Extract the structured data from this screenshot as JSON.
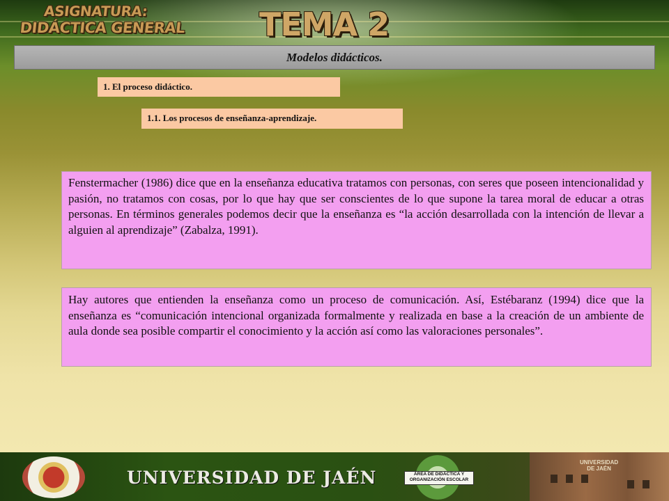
{
  "header": {
    "subject_line1": "ASIGNATURA:",
    "subject_line2": "DIDÁCTICA GENERAL",
    "topic": "TEMA 2"
  },
  "subject_bar": {
    "title": "Modelos didácticos."
  },
  "sections": {
    "section1": "1. El proceso didáctico.",
    "section2": "1.1. Los procesos de enseñanza-aprendizaje."
  },
  "paragraphs": {
    "p1": " Fenstermacher (1986) dice que en la enseñanza educativa tratamos con personas, con seres que poseen intencionalidad y pasión, no tratamos con cosas, por lo que hay que ser conscientes de lo que supone la tarea moral de educar a otras personas. En términos generales podemos decir que la enseñanza es “la acción desarrollada con la intención de llevar a alguien al aprendizaje” (Zabalza, 1991).",
    "p2": "Hay autores que entienden la enseñanza como un proceso de comunicación. Así, Estébaranz (1994) dice que la enseñanza es “comunicación intencional organizada formalmente y realizada en base a la creación de un ambiente de aula donde sea posible compartir el conocimiento y la acción así como las valoraciones personales”."
  },
  "footer": {
    "university": "UNIVERSIDAD DE JAÉN",
    "dept_line1": "ÁREA DE DIDÁCTICA Y",
    "dept_line2": "ORGANIZACIÓN ESCOLAR",
    "building_sign_line1": "UNIVERSIDAD",
    "building_sign_line2": "DE JAÉN"
  },
  "colors": {
    "section_fill": "#fbc9a3",
    "text_box_fill": "#f39ff0",
    "subject_bar_fill": "#a8a8a8"
  }
}
